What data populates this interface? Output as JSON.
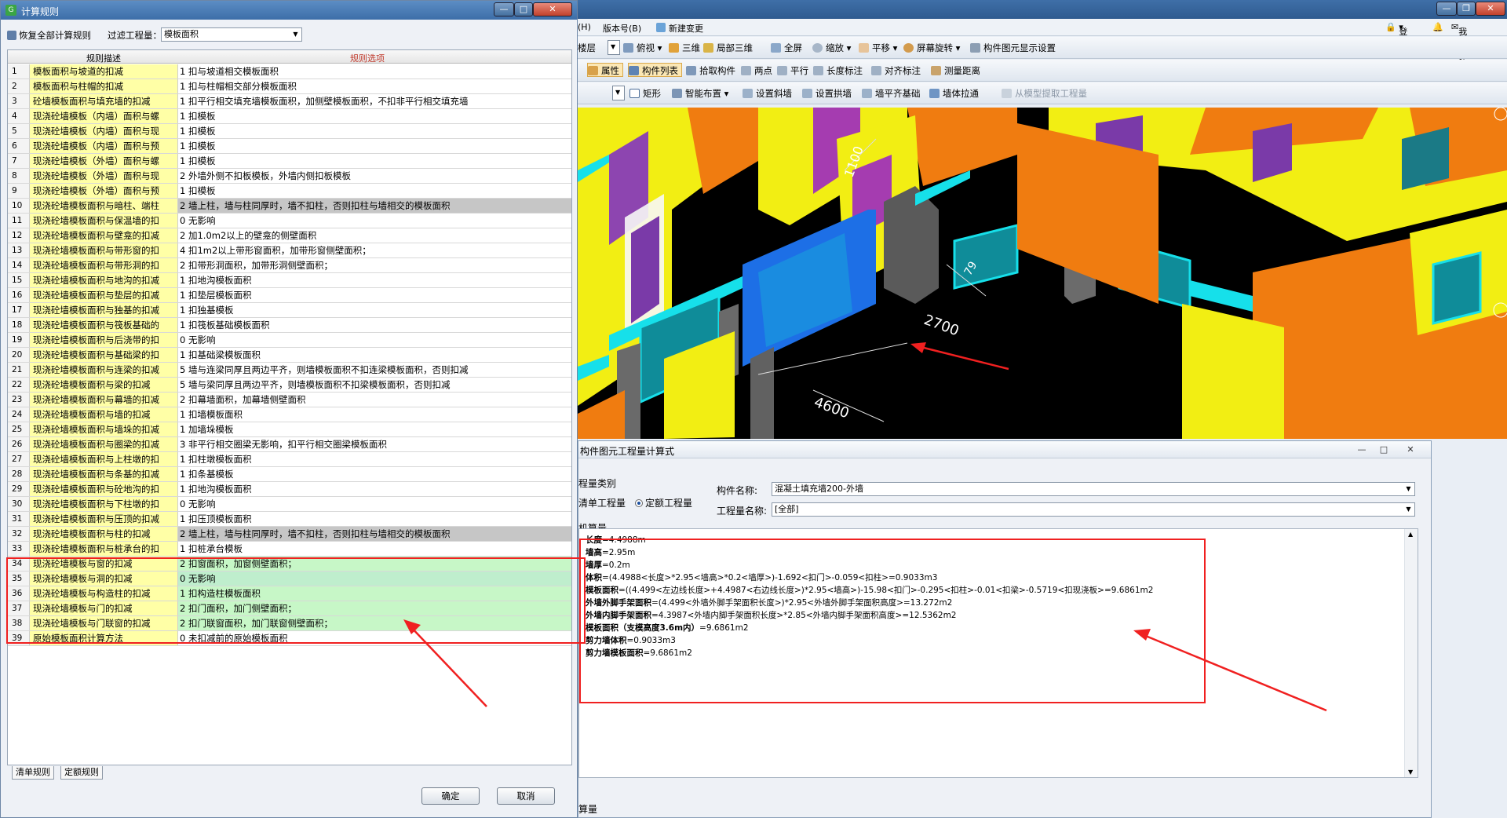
{
  "app": {
    "menu": [
      "(H)",
      "版本号(B)",
      "新建变更"
    ],
    "toolbar1": [
      "楼层",
      "俯视",
      "三维",
      "局部三维",
      "全屏",
      "缩放",
      "平移",
      "屏幕旋转",
      "构件图元显示设置"
    ],
    "toolbar2": [
      "属性",
      "构件列表",
      "拾取构件",
      "两点",
      "平行",
      "长度标注",
      "对齐标注",
      "测量距离"
    ],
    "toolbar3": [
      "矩形",
      "智能布置",
      "设置斜墙",
      "设置拱墙",
      "墙平齐基础",
      "墙体拉通",
      "从模型提取工程量"
    ],
    "right_controls": [
      "登录",
      "我要建议"
    ]
  },
  "viewport": {
    "dims": [
      "1100",
      "2700",
      "4600",
      "79"
    ]
  },
  "formula_dialog": {
    "title": "构件图元工程量计算式",
    "quantity_type_label": "程量类别",
    "radio_list": "清单工程量",
    "radio_quota": "定额工程量",
    "component_name_label": "构件名称:",
    "component_name_value": "混凝土填充墙200-外墙",
    "quantity_name_label": "工程量名称:",
    "quantity_name_value": "[全部]",
    "section_label": "机算量",
    "lines": [
      {
        "k": "长度",
        "v": "=4.4988m"
      },
      {
        "k": "墙高",
        "v": "=2.95m"
      },
      {
        "k": "墙厚",
        "v": "=0.2m"
      },
      {
        "k": "体积",
        "v": "=(4.4988<长度>*2.95<墙高>*0.2<墙厚>)-1.692<扣门>-0.059<扣柱>=0.9033m3"
      },
      {
        "k": "模板面积",
        "v": "=((4.499<左边线长度>+4.4987<右边线长度>)*2.95<墙高>)-15.98<扣门>-0.295<扣柱>-0.01<扣梁>-0.5719<扣现浇板>=9.6861m2"
      },
      {
        "k": "外墙外脚手架面积",
        "v": "=(4.499<外墙外脚手架面积长度>)*2.95<外墙外脚手架面积高度>=13.272m2"
      },
      {
        "k": "外墙内脚手架面积",
        "v": "=4.3987<外墙内脚手架面积长度>*2.85<外墙内脚手架面积高度>=12.5362m2"
      },
      {
        "k": "模板面积（支模高度3.6m内）",
        "v": "=9.6861m2"
      },
      {
        "k": "剪力墙体积",
        "v": "=0.9033m3"
      },
      {
        "k": "剪力墙模板面积",
        "v": "=9.6861m2"
      }
    ],
    "bottom_label": "算量"
  },
  "rules_dialog": {
    "title": "计算规则",
    "restore_label": "恢复全部计算规则",
    "filter_label": "过滤工程量：",
    "filter_value": "模板面积",
    "col_desc": "规则描述",
    "col_option": "规则选项",
    "rows": [
      {
        "n": "1",
        "d": "模板面积与坡道的扣减",
        "o": "1 扣与坡道相交模板面积"
      },
      {
        "n": "2",
        "d": "模板面积与柱帽的扣减",
        "o": "1 扣与柱帽相交部分模板面积"
      },
      {
        "n": "3",
        "d": "砼墙模板面积与填充墙的扣减",
        "o": "1 扣平行相交填充墙模板面积，加侧壁模板面积，不扣非平行相交填充墙"
      },
      {
        "n": "4",
        "d": "现浇砼墙模板（内墙）面积与螺",
        "o": "1  扣模板"
      },
      {
        "n": "5",
        "d": "现浇砼墙模板（内墙）面积与现",
        "o": "1  扣模板"
      },
      {
        "n": "6",
        "d": "现浇砼墙模板（内墙）面积与预",
        "o": "1  扣模板"
      },
      {
        "n": "7",
        "d": "现浇砼墙模板（外墙）面积与螺",
        "o": "1  扣模板"
      },
      {
        "n": "8",
        "d": "现浇砼墙模板（外墙）面积与现",
        "o": "2  外墙外侧不扣板模板，外墙内侧扣板模板"
      },
      {
        "n": "9",
        "d": "现浇砼墙模板（外墙）面积与预",
        "o": "1  扣模板"
      },
      {
        "n": "10",
        "d": "现浇砼墙模板面积与暗柱、端柱",
        "o": "2  墙上柱，墙与柱同厚时，墙不扣柱，否则扣柱与墙相交的模板面积"
      },
      {
        "n": "11",
        "d": "现浇砼墙模板面积与保温墙的扣",
        "o": "0 无影响"
      },
      {
        "n": "12",
        "d": "现浇砼墙模板面积与壁龛的扣减",
        "o": "2  加1.0m2以上的壁龛的侧壁面积"
      },
      {
        "n": "13",
        "d": "现浇砼墙模板面积与带形窗的扣",
        "o": "4  扣1m2以上带形窗面积，加带形窗侧壁面积；"
      },
      {
        "n": "14",
        "d": "现浇砼墙模板面积与带形洞的扣",
        "o": "2  扣带形洞面积，加带形洞侧壁面积；"
      },
      {
        "n": "15",
        "d": "现浇砼墙模板面积与地沟的扣减",
        "o": "1  扣地沟模板面积"
      },
      {
        "n": "16",
        "d": "现浇砼墙模板面积与垫层的扣减",
        "o": "1  扣垫层模板面积"
      },
      {
        "n": "17",
        "d": "现浇砼墙模板面积与独基的扣减",
        "o": "1  扣独基模板"
      },
      {
        "n": "18",
        "d": "现浇砼墙模板面积与筏板基础的",
        "o": "1  扣筏板基础模板面积"
      },
      {
        "n": "19",
        "d": "现浇砼墙模板面积与后浇带的扣",
        "o": "0 无影响"
      },
      {
        "n": "20",
        "d": "现浇砼墙模板面积与基础梁的扣",
        "o": "1  扣基础梁模板面积"
      },
      {
        "n": "21",
        "d": "现浇砼墙模板面积与连梁的扣减",
        "o": "5 墙与连梁同厚且两边平齐，则墙模板面积不扣连梁模板面积，否则扣减"
      },
      {
        "n": "22",
        "d": "现浇砼墙模板面积与梁的扣减",
        "o": "5  墙与梁同厚且两边平齐，则墙模板面积不扣梁模板面积，否则扣减"
      },
      {
        "n": "23",
        "d": "现浇砼墙模板面积与幕墙的扣减",
        "o": "2 扣幕墙面积，加幕墙侧壁面积"
      },
      {
        "n": "24",
        "d": "现浇砼墙模板面积与墙的扣减",
        "o": "1  扣墙模板面积"
      },
      {
        "n": "25",
        "d": "现浇砼墙模板面积与墙垛的扣减",
        "o": "1  加墙垛模板"
      },
      {
        "n": "26",
        "d": "现浇砼墙模板面积与圈梁的扣减",
        "o": "3  非平行相交圈梁无影响，扣平行相交圈梁模板面积"
      },
      {
        "n": "27",
        "d": "现浇砼墙模板面积与上柱墩的扣",
        "o": "1  扣柱墩模板面积"
      },
      {
        "n": "28",
        "d": "现浇砼墙模板面积与条基的扣减",
        "o": "1  扣条基模板"
      },
      {
        "n": "29",
        "d": "现浇砼墙模板面积与砼地沟的扣",
        "o": "1  扣地沟模板面积"
      },
      {
        "n": "30",
        "d": "现浇砼墙模板面积与下柱墩的扣",
        "o": "0 无影响"
      },
      {
        "n": "31",
        "d": "现浇砼墙模板面积与压顶的扣减",
        "o": "1  扣压顶模板面积"
      },
      {
        "n": "32",
        "d": "现浇砼墙模板面积与柱的扣减",
        "o": "2  墙上柱，墙与柱同厚时，墙不扣柱，否则扣柱与墙相交的模板面积"
      },
      {
        "n": "33",
        "d": "现浇砼墙模板面积与桩承台的扣",
        "o": "1  扣桩承台模板"
      },
      {
        "n": "34",
        "d": "现浇砼墙模板与窗的扣减",
        "o": "2   扣窗面积，加窗侧壁面积；"
      },
      {
        "n": "35",
        "d": "现浇砼墙模板与洞的扣减",
        "o": "0 无影响"
      },
      {
        "n": "36",
        "d": "现浇砼墙模板与构造柱的扣减",
        "o": "1   扣构造柱模板面积"
      },
      {
        "n": "37",
        "d": "现浇砼墙模板与门的扣减",
        "o": "2  扣门面积，加门侧壁面积；"
      },
      {
        "n": "38",
        "d": "现浇砼墙模板与门联窗的扣减",
        "o": "2  扣门联窗面积，加门联窗侧壁面积；"
      },
      {
        "n": "39",
        "d": "原始模板面积计算方法",
        "o": "0 未扣减前的原始模板面积"
      }
    ],
    "tab_list": "清单规则",
    "tab_quota": "定额规则",
    "ok_label": "确定",
    "cancel_label": "取消"
  },
  "colors": {
    "desc_bg": "#ffffa6",
    "highlight_red": "#f02020",
    "wall_yellow": "#f2ee13",
    "wall_orange": "#f07c10",
    "wall_cyan": "#16e0ea",
    "selected_blue": "#1d6fe6"
  }
}
